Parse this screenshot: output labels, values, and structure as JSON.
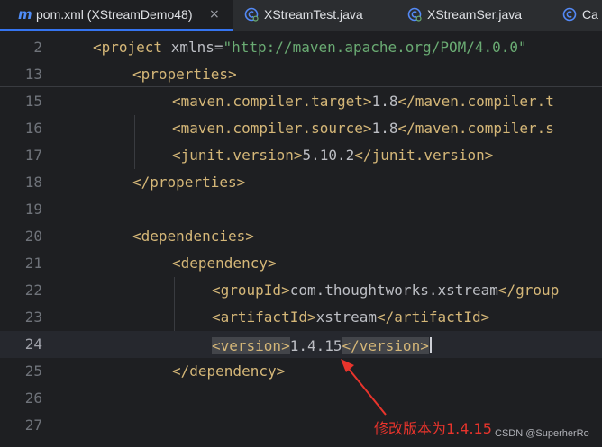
{
  "tabs": [
    {
      "icon": "maven-m-icon",
      "label": "pom.xml (XStreamDemo48)",
      "active": true,
      "close": "×"
    },
    {
      "icon": "java-class-icon",
      "label": "XStreamTest.java",
      "active": false
    },
    {
      "icon": "java-class-icon",
      "label": "XStreamSer.java",
      "active": false
    },
    {
      "icon": "java-class-icon",
      "label": "Ca",
      "active": false
    }
  ],
  "icons": {
    "m_glyph": "m",
    "c_glyph": "C"
  },
  "editor": {
    "lines": [
      {
        "num": "2",
        "project_open": "<project",
        "project_attr": " xmlns=",
        "project_ns": "\"http://maven.apache.org/POM/4.0.0\""
      },
      {
        "num": "13",
        "text": "<properties>"
      },
      {
        "num": "15",
        "open": "<maven.compiler.target>",
        "value": "1.8",
        "close": "</maven.compiler.t"
      },
      {
        "num": "16",
        "open": "<maven.compiler.source>",
        "value": "1.8",
        "close": "</maven.compiler.s"
      },
      {
        "num": "17",
        "open": "<junit.version>",
        "value": "5.10.2",
        "close": "</junit.version>"
      },
      {
        "num": "18",
        "text": "</properties>"
      },
      {
        "num": "19"
      },
      {
        "num": "20",
        "text": "<dependencies>"
      },
      {
        "num": "21",
        "text": "<dependency>"
      },
      {
        "num": "22",
        "open": "<groupId>",
        "value": "com.thoughtworks.xstream",
        "close": "</group"
      },
      {
        "num": "23",
        "open": "<artifactId>",
        "value": "xstream",
        "close": "</artifactId>"
      },
      {
        "num": "24",
        "open": "<version>",
        "value": "1.4.15",
        "close": "</version>"
      },
      {
        "num": "25",
        "text": "</dependency>"
      },
      {
        "num": "26"
      },
      {
        "num": "27"
      }
    ]
  },
  "annotation": {
    "text": "修改版本为1.4.15",
    "color": "#e8342c"
  },
  "watermark": "CSDN @SuperherRo",
  "colors": {
    "accent": "#3574f0",
    "tag": "#d5b778",
    "string": "#6aab73",
    "annotation": "#e8342c"
  }
}
